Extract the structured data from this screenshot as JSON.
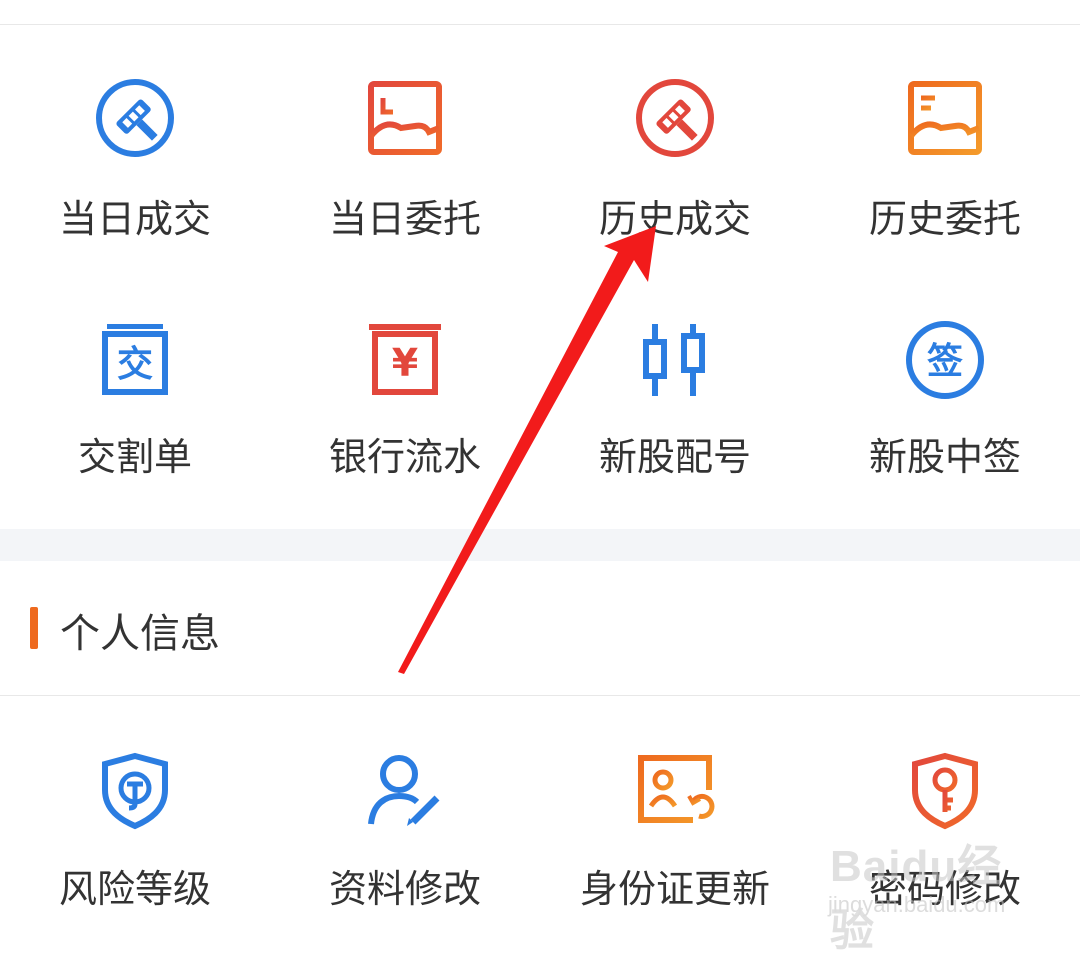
{
  "grid_row_1": [
    {
      "label": "当日成交",
      "icon": "trade-hammer-icon",
      "color": "#2b7de1"
    },
    {
      "label": "当日委托",
      "icon": "hand-card-icon",
      "color": "#e2473c"
    },
    {
      "label": "历史成交",
      "icon": "trade-hammer-icon",
      "color": "#e2473c"
    },
    {
      "label": "历史委托",
      "icon": "hand-card-icon",
      "color": "#ee7a1f"
    }
  ],
  "grid_row_2": [
    {
      "label": "交割单",
      "icon": "delivery-note-icon",
      "glyph": "交",
      "color": "#2b7de1"
    },
    {
      "label": "银行流水",
      "icon": "bank-statement-icon",
      "glyph": "¥",
      "color": "#e2473c"
    },
    {
      "label": "新股配号",
      "icon": "candlestick-icon",
      "color": "#2b7de1"
    },
    {
      "label": "新股中签",
      "icon": "lottery-win-icon",
      "glyph": "签",
      "color": "#2b7de1"
    }
  ],
  "section": {
    "title": "个人信息",
    "accent": "#ee6a1f"
  },
  "personal_info": [
    {
      "label": "风险等级",
      "icon": "shield-risk-icon",
      "color": "#2b7de1"
    },
    {
      "label": "资料修改",
      "icon": "user-edit-icon",
      "color": "#2b7de1"
    },
    {
      "label": "身份证更新",
      "icon": "id-card-refresh-icon",
      "color": "#ee7a1f"
    },
    {
      "label": "密码修改",
      "icon": "shield-key-icon",
      "color": "#e2473c"
    }
  ],
  "watermark": {
    "text": "Baidu经验",
    "url": "jingyan.baidu.com"
  }
}
